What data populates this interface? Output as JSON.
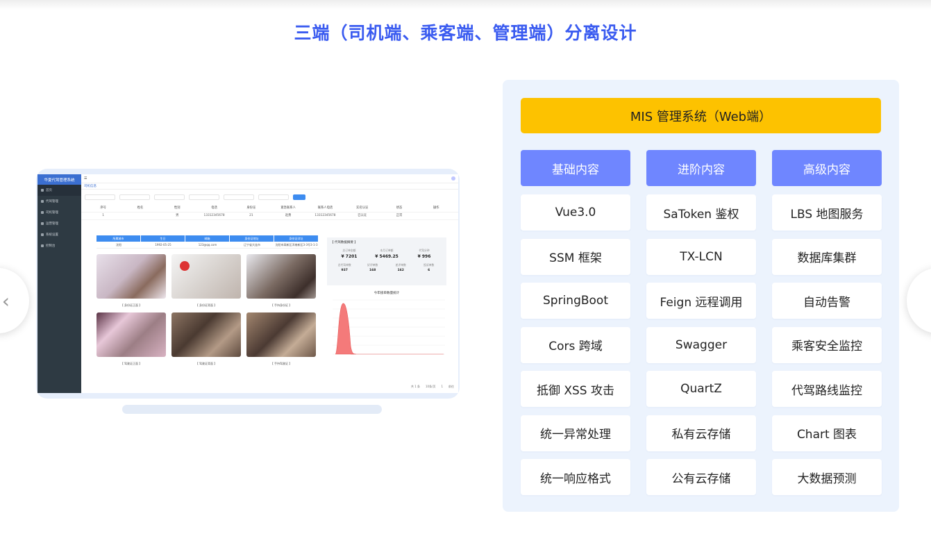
{
  "title": "三端（司机端、乘客端、管理端）分离设计",
  "mockup": {
    "sidebar_title": "华夏代驾管理系统",
    "sidebar_items": [
      "首页",
      "代驾管理",
      "司机管理",
      "运营管理",
      "系统设置",
      "控制台"
    ],
    "tab": "司机信息",
    "filter_button": "查询",
    "list_headers": [
      "序号",
      "姓名",
      "性别",
      "电话",
      "身份证",
      "紧急联系人",
      "联系人电话",
      "实名认证",
      "状态",
      "操作"
    ],
    "list_row": [
      "1",
      "",
      "男",
      "13312345678",
      "21",
      "赵勇",
      "13312345678",
      "已认证",
      "正常",
      ""
    ],
    "detail_headers": [
      "所属城市",
      "生日",
      "邮箱",
      "身份证地址",
      "身份证详址"
    ],
    "detail_row": [
      "沈阳",
      "1992-05-25",
      "123@qq.com",
      "辽宁省大连市",
      "沈阳市高新区浑南新区3-3号3-1-3"
    ],
    "captions": [
      "【 身份证正面 】",
      "【 身份证背面 】",
      "【 手持身份证 】",
      "【 驾驶证正面 】",
      "【 驾驶证背面 】",
      "【 手持驾驶证 】"
    ],
    "stats_title": "【 代驾数据摘要 】",
    "stats_row1": [
      {
        "label": "总订单金额",
        "value": "¥ 7201"
      },
      {
        "label": "本月订单额",
        "value": "¥ 5469.25"
      },
      {
        "label": "代驾分钟",
        "value": "¥ 996"
      }
    ],
    "stats_row2": [
      {
        "label": "总代驾单数",
        "value": "937"
      },
      {
        "label": "好评单数",
        "value": "168"
      },
      {
        "label": "差评单数",
        "value": "162"
      },
      {
        "label": "投诉单数",
        "value": "6"
      }
    ],
    "chart_title": "今年接单数量统计",
    "pager": [
      "共 1 条",
      "10条/页",
      "1",
      "前往"
    ]
  },
  "panel": {
    "banner": "MIS 管理系统（Web端）",
    "columns": [
      {
        "head": "基础内容",
        "items": [
          "Vue3.0",
          "SSM 框架",
          "SpringBoot",
          "Cors 跨域",
          "抵御 XSS 攻击",
          "统一异常处理",
          "统一响应格式"
        ]
      },
      {
        "head": "进阶内容",
        "items": [
          "SaToken 鉴权",
          "TX-LCN",
          "Feign 远程调用",
          "Swagger",
          "QuartZ",
          "私有云存储",
          "公有云存储"
        ]
      },
      {
        "head": "高级内容",
        "items": [
          "LBS 地图服务",
          "数据库集群",
          "自动告警",
          "乘客安全监控",
          "代驾路线监控",
          "Chart 图表",
          "大数据预测"
        ]
      }
    ]
  },
  "colors": {
    "title": "#3a5bf0",
    "banner": "#fdc200",
    "column_head": "#6f86ff",
    "panel_bg": "#ecf3fd"
  }
}
